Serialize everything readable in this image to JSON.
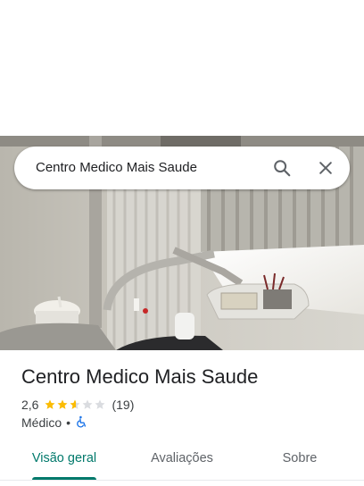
{
  "search": {
    "query": "Centro Medico Mais Saude"
  },
  "place": {
    "name": "Centro Medico Mais Saude",
    "rating": "2,6",
    "rating_value": 2.6,
    "review_count": "(19)",
    "category": "Médico",
    "separator": "•"
  },
  "tabs": [
    {
      "label": "Visão geral",
      "selected": true
    },
    {
      "label": "Avaliações",
      "selected": false
    },
    {
      "label": "Sobre",
      "selected": false
    }
  ],
  "icons": {
    "search": "search-icon",
    "close": "close-icon",
    "accessibility": "wheelchair-icon"
  },
  "colors": {
    "star": "#fbbc04",
    "star_empty": "#dadce0",
    "accent": "#00796b",
    "accessibility": "#1a73e8"
  }
}
